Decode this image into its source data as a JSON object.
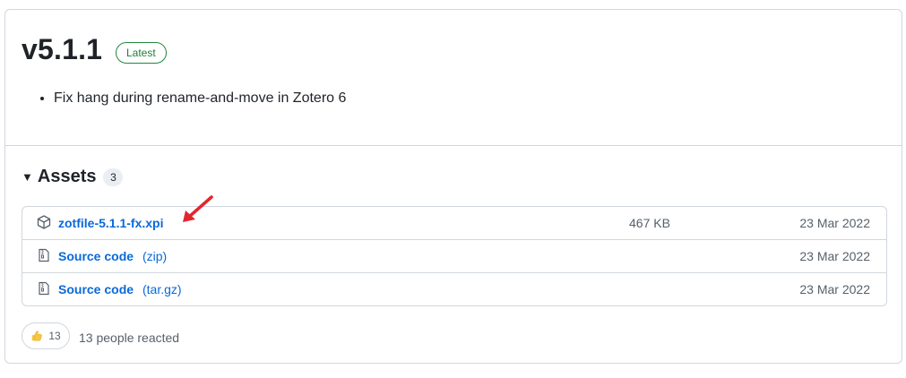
{
  "release": {
    "version": "v5.1.1",
    "badge": "Latest",
    "notes": [
      "Fix hang during rename-and-move in Zotero 6"
    ]
  },
  "assets": {
    "title": "Assets",
    "count": "3",
    "rows": [
      {
        "icon": "package-icon",
        "name": "zotfile-5.1.1-fx.xpi",
        "ext": "",
        "size": "467 KB",
        "date": "23 Mar 2022"
      },
      {
        "icon": "file-zip-icon",
        "name": "Source code",
        "ext": "(zip)",
        "size": "",
        "date": "23 Mar 2022"
      },
      {
        "icon": "file-zip-icon",
        "name": "Source code",
        "ext": "(tar.gz)",
        "size": "",
        "date": "23 Mar 2022"
      }
    ]
  },
  "reactions": {
    "icon": "thumbs-up-icon",
    "count": "13",
    "summary": "13 people reacted"
  },
  "colors": {
    "accent_link": "#0969da",
    "badge_green": "#1a7f37",
    "annotation_arrow": "#e3262e"
  }
}
